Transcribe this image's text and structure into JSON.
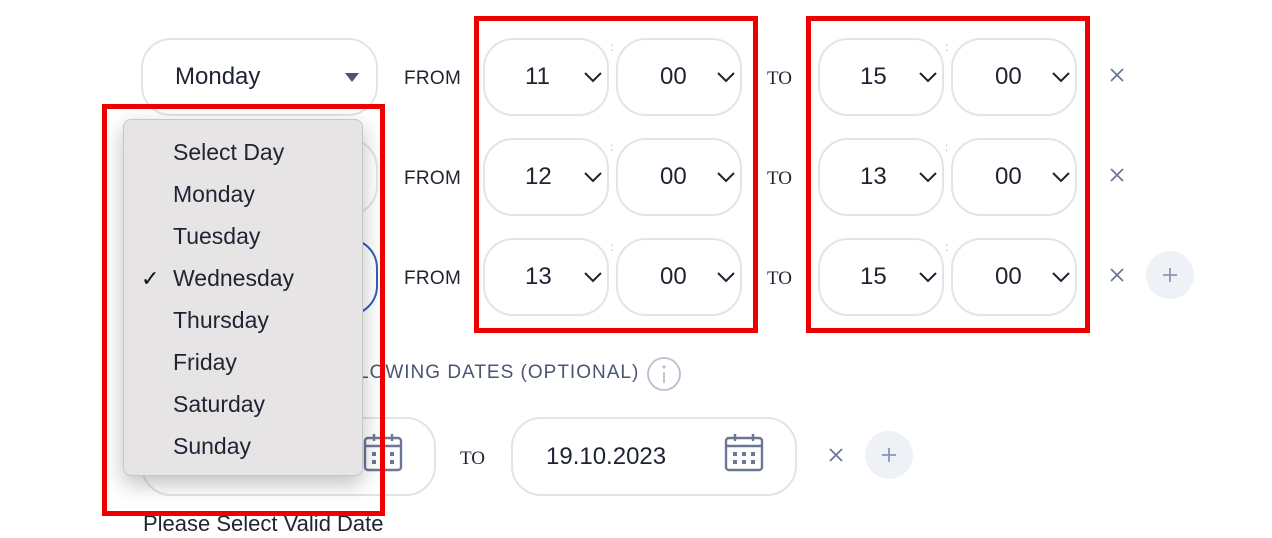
{
  "rows": [
    {
      "day": "Monday",
      "from_label": "FROM",
      "from_hour": "11",
      "from_min": "00",
      "to_label": "TO",
      "to_hour": "15",
      "to_min": "00"
    },
    {
      "day": "",
      "from_label": "FROM",
      "from_hour": "12",
      "from_min": "00",
      "to_label": "TO",
      "to_hour": "13",
      "to_min": "00"
    },
    {
      "day": "",
      "from_label": "FROM",
      "from_hour": "13",
      "from_min": "00",
      "to_label": "TO",
      "to_hour": "15",
      "to_min": "00"
    }
  ],
  "time_separator": ":",
  "dates_section": {
    "heading": "LOWING DATES (OPTIONAL)",
    "to_label": "TO",
    "end_date": "19.10.2023",
    "error": "Please Select Valid Date"
  },
  "dropdown": {
    "options": [
      "Select Day",
      "Monday",
      "Tuesday",
      "Wednesday",
      "Thursday",
      "Friday",
      "Saturday",
      "Sunday"
    ],
    "selected": "Wednesday",
    "check_glyph": "✓"
  },
  "icons": {
    "close": "close-icon",
    "add": "plus-icon",
    "calendar": "calendar-icon",
    "info": "info-icon",
    "chevron": "chevron-down-icon"
  },
  "colors": {
    "highlight_border": "#ee0000",
    "focus_border": "#2f5fb8",
    "pill_border": "#e1e4ea",
    "muted_text": "#4a5573"
  }
}
